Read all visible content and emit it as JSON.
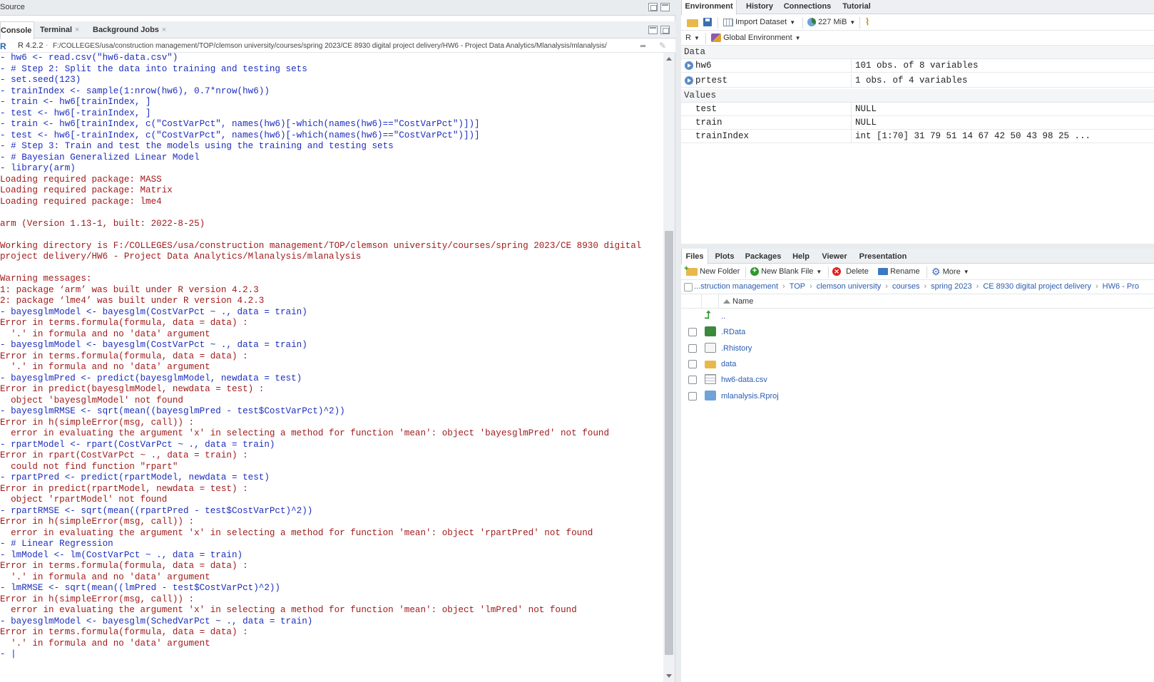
{
  "source_pane": {
    "label": "Source"
  },
  "console_pane": {
    "tabs": [
      {
        "label": "Console",
        "active": true
      },
      {
        "label": "Terminal"
      },
      {
        "label": "Background Jobs"
      }
    ],
    "r_version": "R 4.2.2",
    "path_sep": "·",
    "working_path": "F:/COLLEGES/usa/construction management/TOP/clemson university/courses/spring 2023/CE 8930 digital project delivery/HW6 - Project Data Analytics/Mlanalysis/mlanalysis/",
    "lines": [
      {
        "t": "cmd",
        "text": "- hw6 <- read.csv(\"hw6-data.csv\")"
      },
      {
        "t": "cmd",
        "text": "- # Step 2: Split the data into training and testing sets"
      },
      {
        "t": "cmd",
        "text": "- set.seed(123)"
      },
      {
        "t": "cmd",
        "text": "- trainIndex <- sample(1:nrow(hw6), 0.7*nrow(hw6))"
      },
      {
        "t": "cmd",
        "text": "- train <- hw6[trainIndex, ]"
      },
      {
        "t": "cmd",
        "text": "- test <- hw6[-trainIndex, ]"
      },
      {
        "t": "cmd",
        "text": "- train <- hw6[trainIndex, c(\"CostVarPct\", names(hw6)[-which(names(hw6)==\"CostVarPct\")])]"
      },
      {
        "t": "cmd",
        "text": "- test <- hw6[-trainIndex, c(\"CostVarPct\", names(hw6)[-which(names(hw6)==\"CostVarPct\")])]"
      },
      {
        "t": "cmd",
        "text": "- # Step 3: Train and test the models using the training and testing sets"
      },
      {
        "t": "cmd",
        "text": "- # Bayesian Generalized Linear Model"
      },
      {
        "t": "cmd",
        "text": "- library(arm)"
      },
      {
        "t": "out",
        "text": "Loading required package: MASS"
      },
      {
        "t": "out",
        "text": "Loading required package: Matrix"
      },
      {
        "t": "out",
        "text": "Loading required package: lme4"
      },
      {
        "t": "out",
        "text": ""
      },
      {
        "t": "out",
        "text": "arm (Version 1.13-1, built: 2022-8-25)"
      },
      {
        "t": "out",
        "text": ""
      },
      {
        "t": "out",
        "text": "Working directory is F:/COLLEGES/usa/construction management/TOP/clemson university/courses/spring 2023/CE 8930 digital"
      },
      {
        "t": "out",
        "text": "project delivery/HW6 - Project Data Analytics/Mlanalysis/mlanalysis"
      },
      {
        "t": "out",
        "text": ""
      },
      {
        "t": "out",
        "text": "Warning messages:"
      },
      {
        "t": "out",
        "text": "1: package ‘arm’ was built under R version 4.2.3"
      },
      {
        "t": "out",
        "text": "2: package ‘lme4’ was built under R version 4.2.3"
      },
      {
        "t": "cmd",
        "text": "- bayesglmModel <- bayesglm(CostVarPct ~ ., data = train)"
      },
      {
        "t": "out",
        "text": "Error in terms.formula(formula, data = data) :"
      },
      {
        "t": "out",
        "text": "  '.' in formula and no 'data' argument"
      },
      {
        "t": "cmd",
        "text": "- bayesglmModel <- bayesglm(CostVarPct ~ ., data = train)"
      },
      {
        "t": "out",
        "text": "Error in terms.formula(formula, data = data) :"
      },
      {
        "t": "out",
        "text": "  '.' in formula and no 'data' argument"
      },
      {
        "t": "cmd",
        "text": "- bayesglmPred <- predict(bayesglmModel, newdata = test)"
      },
      {
        "t": "out",
        "text": "Error in predict(bayesglmModel, newdata = test) :"
      },
      {
        "t": "out",
        "text": "  object 'bayesglmModel' not found"
      },
      {
        "t": "cmd",
        "text": "- bayesglmRMSE <- sqrt(mean((bayesglmPred - test$CostVarPct)^2))"
      },
      {
        "t": "out",
        "text": "Error in h(simpleError(msg, call)) :"
      },
      {
        "t": "out",
        "text": "  error in evaluating the argument 'x' in selecting a method for function 'mean': object 'bayesglmPred' not found"
      },
      {
        "t": "cmd",
        "text": "- rpartModel <- rpart(CostVarPct ~ ., data = train)"
      },
      {
        "t": "out",
        "text": "Error in rpart(CostVarPct ~ ., data = train) :"
      },
      {
        "t": "out",
        "text": "  could not find function \"rpart\""
      },
      {
        "t": "cmd",
        "text": "- rpartPred <- predict(rpartModel, newdata = test)"
      },
      {
        "t": "out",
        "text": "Error in predict(rpartModel, newdata = test) :"
      },
      {
        "t": "out",
        "text": "  object 'rpartModel' not found"
      },
      {
        "t": "cmd",
        "text": "- rpartRMSE <- sqrt(mean((rpartPred - test$CostVarPct)^2))"
      },
      {
        "t": "out",
        "text": "Error in h(simpleError(msg, call)) :"
      },
      {
        "t": "out",
        "text": "  error in evaluating the argument 'x' in selecting a method for function 'mean': object 'rpartPred' not found"
      },
      {
        "t": "cmd",
        "text": "- # Linear Regression"
      },
      {
        "t": "cmd",
        "text": "- lmModel <- lm(CostVarPct ~ ., data = train)"
      },
      {
        "t": "out",
        "text": "Error in terms.formula(formula, data = data) :"
      },
      {
        "t": "out",
        "text": "  '.' in formula and no 'data' argument"
      },
      {
        "t": "cmd",
        "text": "- lmRMSE <- sqrt(mean((lmPred - test$CostVarPct)^2))"
      },
      {
        "t": "out",
        "text": "Error in h(simpleError(msg, call)) :"
      },
      {
        "t": "out",
        "text": "  error in evaluating the argument 'x' in selecting a method for function 'mean': object 'lmPred' not found"
      },
      {
        "t": "cmd",
        "text": "- bayesglmModel <- bayesglm(SchedVarPct ~ ., data = train)"
      },
      {
        "t": "out",
        "text": "Error in terms.formula(formula, data = data) :"
      },
      {
        "t": "out",
        "text": "  '.' in formula and no 'data' argument"
      },
      {
        "t": "prompt",
        "text": "- |"
      }
    ]
  },
  "env_pane": {
    "tabs": [
      "Environment",
      "History",
      "Connections",
      "Tutorial"
    ],
    "active_tab": "Environment",
    "toolbar": {
      "import_label": "Import Dataset",
      "memory_label": "227 MiB"
    },
    "lang_label": "R",
    "scope_label": "Global Environment",
    "data_header": "Data",
    "values_header": "Values",
    "data_rows": [
      {
        "name": "hw6",
        "value": "101 obs. of 8 variables"
      },
      {
        "name": "prtest",
        "value": "1 obs. of 4 variables"
      }
    ],
    "value_rows": [
      {
        "name": "test",
        "value": "NULL"
      },
      {
        "name": "train",
        "value": "NULL"
      },
      {
        "name": "trainIndex",
        "value": "int [1:70] 31 79 51 14 67 42 50 43 98 25 ..."
      }
    ]
  },
  "files_pane": {
    "tabs": [
      "Files",
      "Plots",
      "Packages",
      "Help",
      "Viewer",
      "Presentation"
    ],
    "active_tab": "Files",
    "toolbar": {
      "new_folder": "New Folder",
      "new_file": "New Blank File",
      "delete": "Delete",
      "rename": "Rename",
      "more": "More"
    },
    "breadcrumbs": [
      "...struction management",
      "TOP",
      "clemson university",
      "courses",
      "spring 2023",
      "CE 8930 digital project delivery",
      "HW6 - Pro"
    ],
    "column_name": "Name",
    "files": [
      {
        "name": "..",
        "icon": "up-arrow-icon"
      },
      {
        "name": ".RData",
        "icon": "rdata-icon"
      },
      {
        "name": ".Rhistory",
        "icon": "rhistory-icon"
      },
      {
        "name": "data",
        "icon": "folder-icon"
      },
      {
        "name": "hw6-data.csv",
        "icon": "csv-icon"
      },
      {
        "name": "mlanalysis.Rproj",
        "icon": "rproj-icon"
      }
    ]
  }
}
